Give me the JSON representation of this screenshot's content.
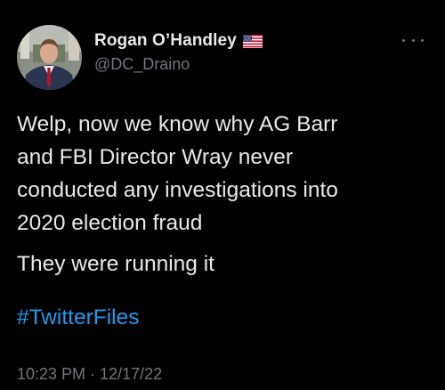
{
  "author": {
    "display_name": "Rogan O’Handley",
    "handle": "@DC_Draino",
    "badge_icon": "us-flag-icon",
    "avatar_icon": "profile-photo"
  },
  "tweet": {
    "lines": [
      "Welp, now we know why AG Barr",
      "and FBI Director Wray never",
      "conducted any investigations into",
      "2020 election fraud"
    ],
    "second_paragraph": "They were running it",
    "hashtag": "#TwitterFiles",
    "timestamp": "10:23 PM · 12/17/22"
  },
  "menu": {
    "icon": "more-options-icon"
  },
  "colors": {
    "background": "#000000",
    "text": "#e7e9ea",
    "muted": "#71767b",
    "link": "#1d9bf0"
  }
}
